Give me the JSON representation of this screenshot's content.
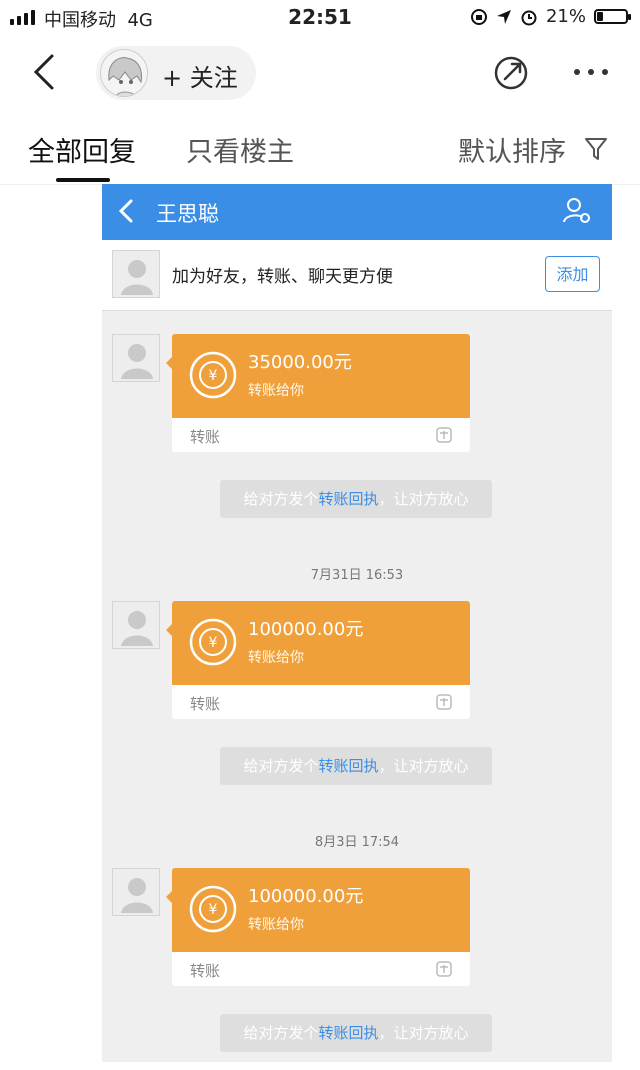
{
  "status_bar": {
    "carrier": "中国移动",
    "network": "4G",
    "time": "22:51",
    "battery_pct_text": "21%",
    "battery_level": 0.21
  },
  "top_nav": {
    "follow_label": "+ 关注"
  },
  "tabs": {
    "all_replies": "全部回复",
    "op_only": "只看楼主",
    "sort_label": "默认排序"
  },
  "chat": {
    "contact_name": "王思聪",
    "friend_banner_text": "加为好友，转账、聊天更方便",
    "add_button": "添加",
    "transfers": [
      {
        "amount": "35000.00元",
        "subtitle": "转账给你",
        "footer": "转账",
        "hint_prefix": "给对方发个",
        "hint_link": "转账回执",
        "hint_suffix": "，让对方放心"
      },
      {
        "timestamp": "7月31日 16:53",
        "amount": "100000.00元",
        "subtitle": "转账给你",
        "footer": "转账",
        "hint_prefix": "给对方发个",
        "hint_link": "转账回执",
        "hint_suffix": "，让对方放心"
      },
      {
        "timestamp": "8月3日 17:54",
        "amount": "100000.00元",
        "subtitle": "转账给你",
        "footer": "转账",
        "hint_prefix": "给对方发个",
        "hint_link": "转账回执",
        "hint_suffix": "，让对方放心"
      }
    ]
  },
  "colors": {
    "header_blue": "#3a8ee6",
    "transfer_orange": "#f0a03a",
    "link_blue": "#3a8ee6"
  }
}
